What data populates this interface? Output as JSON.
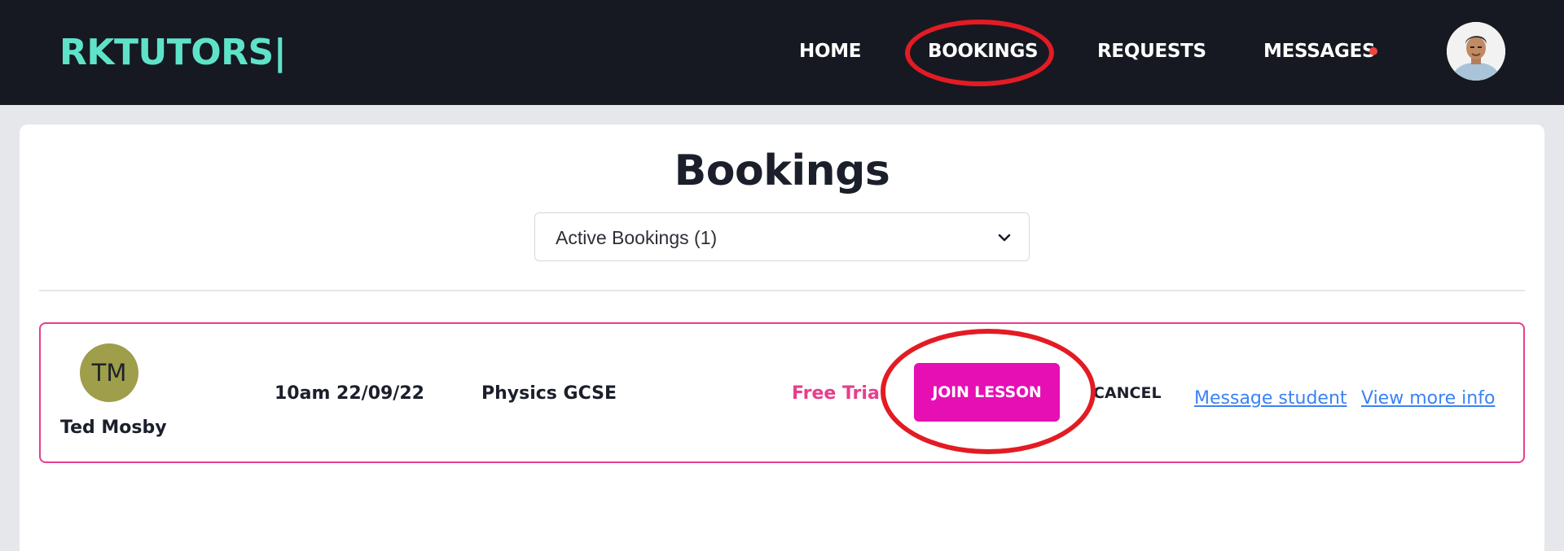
{
  "header": {
    "brand": "RKTUTORS|",
    "nav": {
      "home": "HOME",
      "bookings": "BOOKINGS",
      "requests": "REQUESTS",
      "messages": "MESSAGES"
    },
    "messages_has_notification": true,
    "avatar_icon": "user-profile-photo"
  },
  "main": {
    "title": "Bookings",
    "filter_select": {
      "value": "Active Bookings (1)",
      "icon": "chevron-down-icon"
    },
    "bookings": [
      {
        "initials": "TM",
        "student_name": "Ted Mosby",
        "datetime": "10am 22/09/22",
        "subject": "Physics GCSE",
        "type": "Free Trial",
        "join_label": "JOIN LESSON",
        "cancel_label": "CANCEL",
        "message_link": "Message student",
        "info_link": "View more info"
      }
    ]
  },
  "colors": {
    "navbar_bg": "#161922",
    "brand": "#5fe3c8",
    "accent_pink": "#e83e8c",
    "join_button": "#e60fb3",
    "link_blue": "#3b82f6",
    "avatar_olive": "#9e9e4b",
    "notification_dot": "#ef4444",
    "annotation_red": "#e31b23"
  }
}
